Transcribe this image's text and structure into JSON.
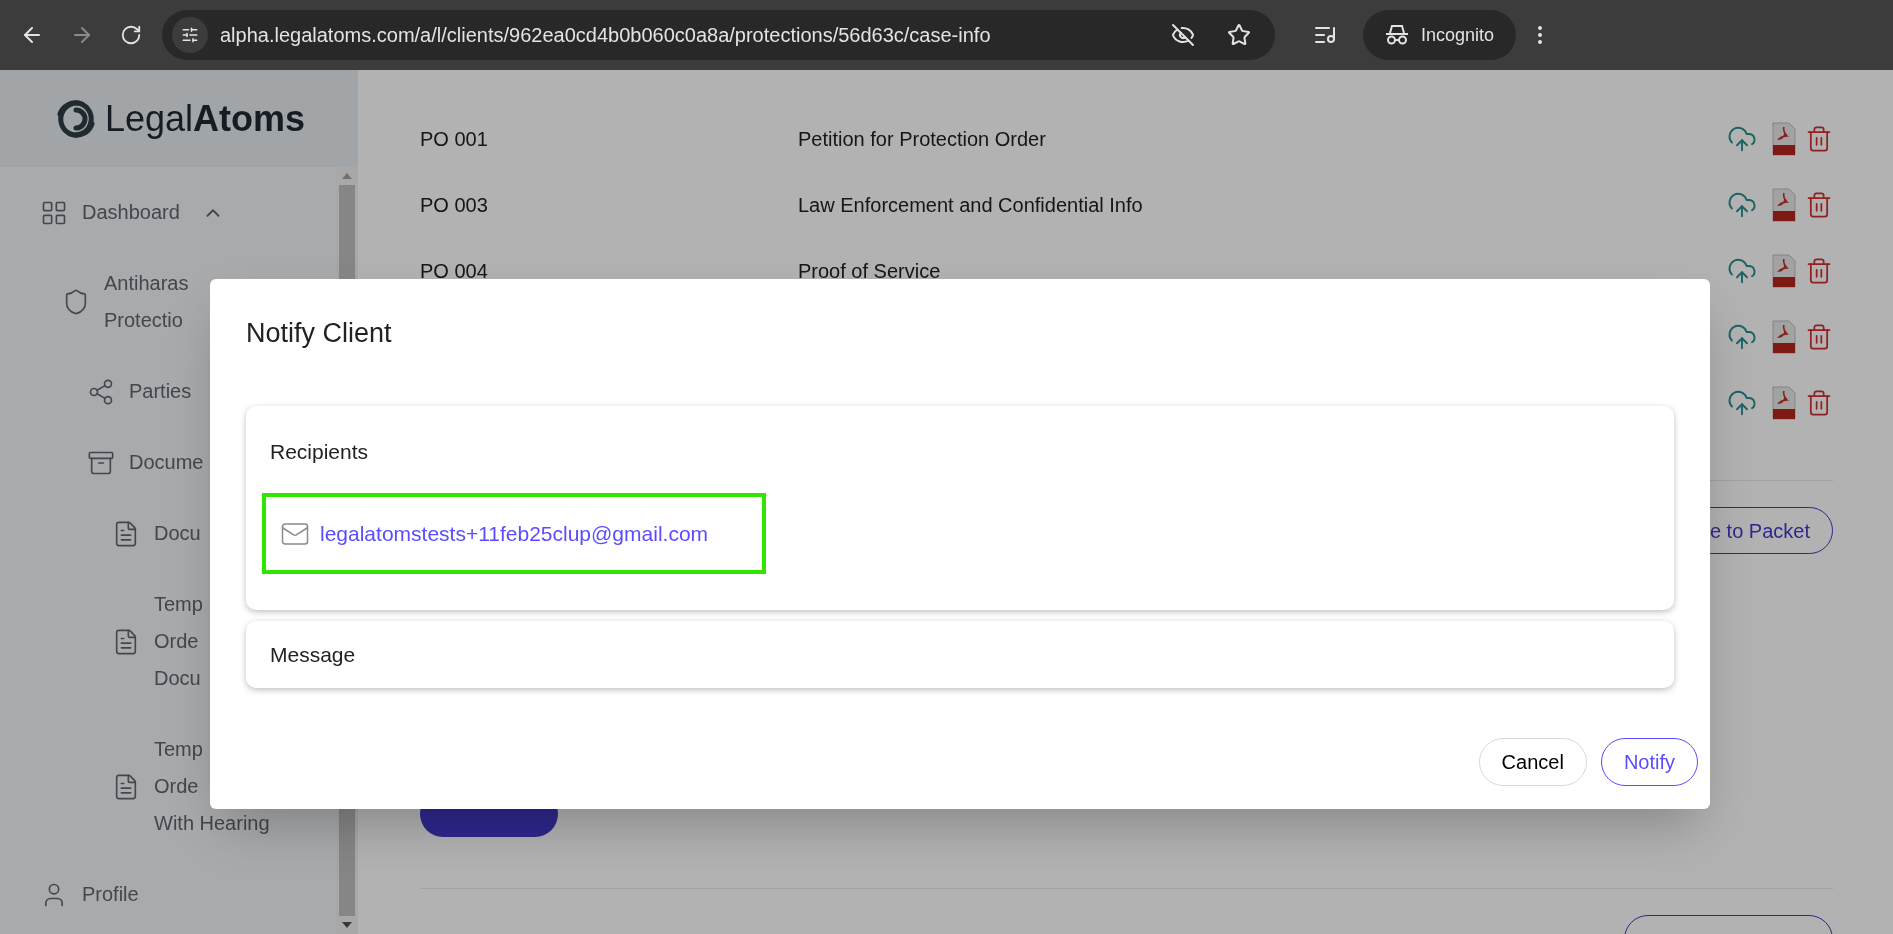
{
  "browser": {
    "url": "alpha.legalatoms.com/a/l/clients/962ea0cd4b0b060c0a8a/protections/56d63c/case-info",
    "profile": "Incognito"
  },
  "sidebar": {
    "logo": {
      "light": "Legal",
      "bold": "Atoms"
    },
    "items": [
      {
        "lines": [
          "Dashboard"
        ],
        "expanded": true,
        "children": [
          {
            "lines": [
              "Antiharas",
              "Protectio"
            ],
            "children": [
              {
                "lines": [
                  "Parties"
                ]
              },
              {
                "lines": [
                  "Docume"
                ],
                "children": [
                  {
                    "lines": [
                      "Docu"
                    ]
                  },
                  {
                    "lines": [
                      "Temp",
                      "Orde",
                      "Docu"
                    ]
                  },
                  {
                    "lines": [
                      "Temp",
                      "Orde",
                      "With Hearing"
                    ]
                  }
                ]
              }
            ]
          }
        ]
      },
      {
        "lines": [
          "Profile"
        ]
      }
    ]
  },
  "main": {
    "documents": [
      {
        "kind": "listed",
        "code": "PO 001",
        "title": "Petition for Protection Order"
      },
      {
        "kind": "listed",
        "code": "PO 003",
        "title": "Law Enforcement and Confidential Info"
      },
      {
        "kind": "listed",
        "code": "PO 004",
        "title": "Proof of Service"
      },
      {
        "kind": "covered"
      },
      {
        "kind": "covered"
      }
    ],
    "add_to_packet": "e to Packet"
  },
  "modal": {
    "title": "Notify Client",
    "recipients_label": "Recipients",
    "recipients": [
      {
        "email": "legalatomstests+11feb25clup@gmail.com",
        "highlighted": true
      }
    ],
    "message_label": "Message",
    "buttons": [
      {
        "label": "Cancel",
        "kind": "secondary"
      },
      {
        "label": "Notify",
        "kind": "primary"
      }
    ]
  }
}
